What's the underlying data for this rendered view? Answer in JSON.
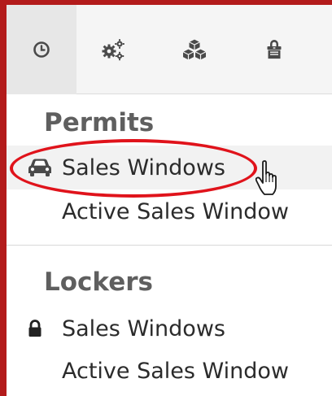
{
  "toolbar": {
    "tools": [
      {
        "icon": "clock-icon",
        "active": true
      },
      {
        "icon": "gears-icon",
        "active": false
      },
      {
        "icon": "cubes-icon",
        "active": false
      },
      {
        "icon": "locker-icon",
        "active": false
      }
    ]
  },
  "menu": {
    "permits": {
      "title": "Permits",
      "items": [
        {
          "label": "Sales Windows",
          "icon": "car-icon",
          "hovered": true
        },
        {
          "label": "Active Sales Window",
          "icon": null,
          "hovered": false
        }
      ]
    },
    "lockers": {
      "title": "Lockers",
      "items": [
        {
          "label": "Sales Windows",
          "icon": "lock-icon",
          "hovered": false
        },
        {
          "label": "Active Sales Window",
          "icon": null,
          "hovered": false
        }
      ]
    }
  },
  "annotation": {
    "highlight_color": "#e0131b",
    "highlighted_item": "Permits > Sales Windows"
  },
  "colors": {
    "frame": "#b31b1b",
    "section_title": "#5f5f5f",
    "item_text": "#2b2b2b",
    "icon": "#4a4a4a"
  }
}
